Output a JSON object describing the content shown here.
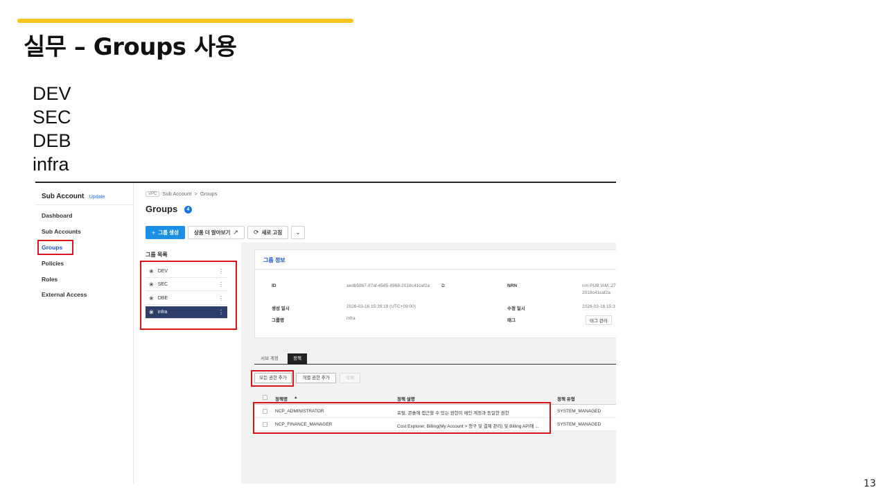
{
  "slide": {
    "title": "실무 – Groups 사용",
    "bullets": [
      "DEV",
      "SEC",
      "DEB",
      "infra"
    ],
    "page_number": "13",
    "accent_color": "#f5c518",
    "highlight_color": "#d7141a"
  },
  "sidebar": {
    "title": "Sub Account",
    "badge": "Update",
    "items": [
      {
        "label": "Dashboard"
      },
      {
        "label": "Sub Accounts"
      },
      {
        "label": "Groups",
        "active": true
      },
      {
        "label": "Policies"
      },
      {
        "label": "Roles"
      },
      {
        "label": "External Access"
      }
    ]
  },
  "header": {
    "breadcrumb": {
      "tag": "VPC",
      "parent": "Sub Account",
      "separator": ">",
      "current": "Groups"
    },
    "title": "Groups",
    "count": "4"
  },
  "toolbar": {
    "create_label": "그룹 생성",
    "learn_more_label": "상품 더 알아보기",
    "refresh_label": "새로 고침",
    "icons": [
      "plus-icon",
      "external-link-icon",
      "refresh-icon",
      "chevron-down-icon"
    ]
  },
  "group_list": {
    "title": "그룹 목록",
    "items": [
      {
        "name": "DEV"
      },
      {
        "name": "SEC"
      },
      {
        "name": "DBE"
      },
      {
        "name": "infra",
        "selected": true
      }
    ]
  },
  "group_info": {
    "title": "그룹 정보",
    "id_label": "ID",
    "id_value": "aedb58b7-87af-4585-8968-2018c41caf2a",
    "nrn_label": "NRN",
    "nrn_value_line1": "nrn:PUB:IAM::27",
    "nrn_value_line2": "2018c41caf2a",
    "created_label": "생성 일시",
    "created_value": "2026-03-16 15:39:19 (UTC+09:00)",
    "modified_label": "수정 일시",
    "modified_value": "2026-03-16 15:3",
    "name_label": "그룹명",
    "name_value": "infra",
    "tag_label": "태그",
    "tag_button": "태그 관리"
  },
  "tabs": [
    {
      "label": "서브 계정"
    },
    {
      "label": "정책",
      "active": true
    }
  ],
  "policy_toolbar": {
    "add_all_label": "모든 권한 추가",
    "add_individual_label": "개별 권한 추가",
    "delete_label": "삭제"
  },
  "policy_table": {
    "headers": {
      "name": "정책명",
      "sort": "▲",
      "description": "정책 설명",
      "type": "정책 유형"
    },
    "rows": [
      {
        "name": "NCP_ADMINISTRATOR",
        "description": "포털, 콘솔에 접근할 수 있는 권한이 메인 계정과 동일한 권한",
        "type": "SYSTEM_MANAGED"
      },
      {
        "name": "NCP_FINANCE_MANAGER",
        "description": "Cost Explorer, Billing(My Account > 청구 및 결제 관리) 및 Billing API에 ...",
        "type": "SYSTEM_MANAGED"
      }
    ]
  }
}
